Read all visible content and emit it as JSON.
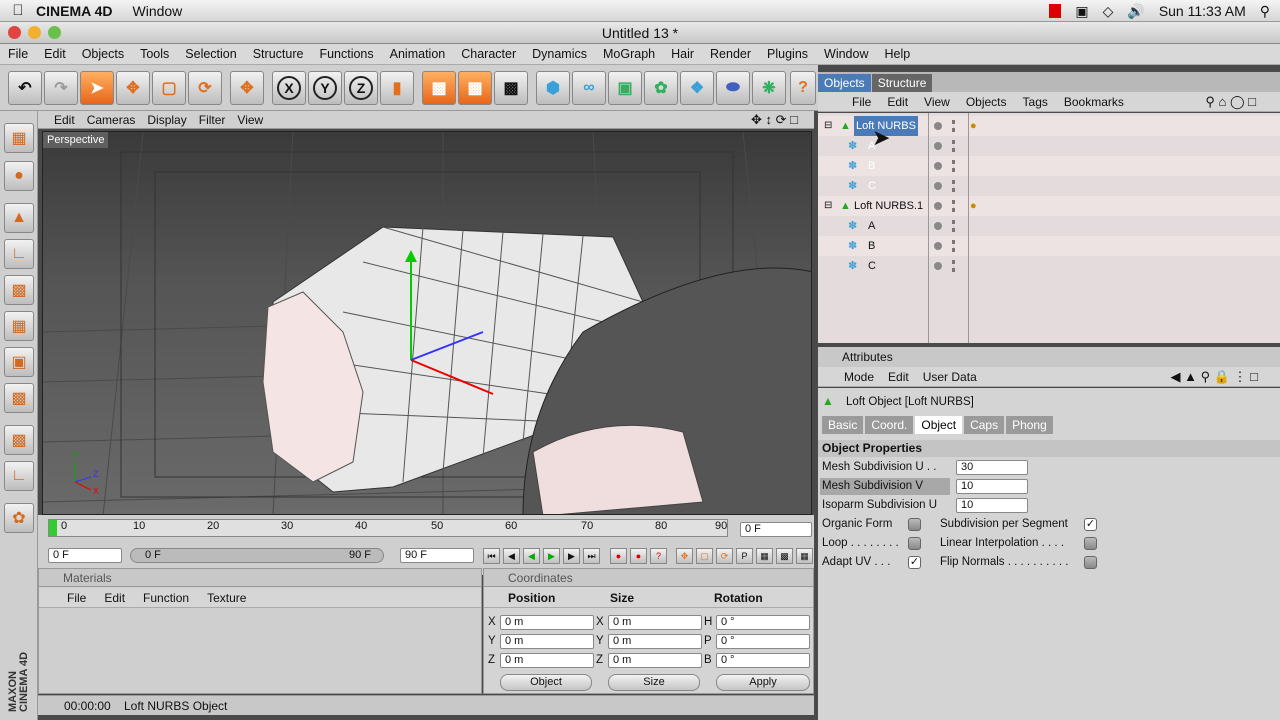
{
  "macbar": {
    "app": "CINEMA 4D",
    "menus": [
      "Window"
    ],
    "clock": "Sun 11:33 AM"
  },
  "window": {
    "title": "Untitled 13 *"
  },
  "appmenu": [
    "File",
    "Edit",
    "Objects",
    "Tools",
    "Selection",
    "Structure",
    "Functions",
    "Animation",
    "Character",
    "Dynamics",
    "MoGraph",
    "Hair",
    "Render",
    "Plugins",
    "Window",
    "Help"
  ],
  "toolbar": {
    "axis_x": "X",
    "axis_y": "Y",
    "axis_z": "Z"
  },
  "viewport": {
    "menu": [
      "Edit",
      "Cameras",
      "Display",
      "Filter",
      "View"
    ],
    "label": "Perspective"
  },
  "timeline": {
    "ticks": [
      "0",
      "10",
      "20",
      "30",
      "40",
      "50",
      "60",
      "70",
      "80",
      "90"
    ],
    "current_frame": "0 F",
    "start": "0 F",
    "range_start": "0 F",
    "range_end": "90 F",
    "end": "90 F",
    "progress": 0
  },
  "materials": {
    "title": "Materials",
    "menu": [
      "File",
      "Edit",
      "Function",
      "Texture"
    ]
  },
  "coordinates": {
    "title": "Coordinates",
    "headers": [
      "Position",
      "Size",
      "Rotation"
    ],
    "rows": [
      {
        "axis": "X",
        "pos": "0 m",
        "size_axis": "X",
        "size": "0 m",
        "rot_axis": "H",
        "rot": "0 °"
      },
      {
        "axis": "Y",
        "pos": "0 m",
        "size_axis": "Y",
        "size": "0 m",
        "rot_axis": "P",
        "rot": "0 °"
      },
      {
        "axis": "Z",
        "pos": "0 m",
        "size_axis": "Z",
        "size": "0 m",
        "rot_axis": "B",
        "rot": "0 °"
      }
    ],
    "mode_select": "Object",
    "size_select": "Size",
    "apply": "Apply"
  },
  "status": {
    "time": "00:00:00",
    "message": "Loft NURBS Object"
  },
  "objects": {
    "tabs": [
      "Objects",
      "Structure"
    ],
    "menu": [
      "File",
      "Edit",
      "View",
      "Objects",
      "Tags",
      "Bookmarks"
    ],
    "rows": [
      {
        "name": "Loft NURBS",
        "child": false
      },
      {
        "name": "A",
        "child": true
      },
      {
        "name": "B",
        "child": true
      },
      {
        "name": "C",
        "child": true
      },
      {
        "name": "Loft NURBS.1",
        "child": false
      },
      {
        "name": "A",
        "child": true
      },
      {
        "name": "B",
        "child": true
      },
      {
        "name": "C",
        "child": true
      }
    ]
  },
  "attributes": {
    "title": "Attributes",
    "menu": [
      "Mode",
      "Edit",
      "User Data"
    ],
    "object_title": "Loft Object [Loft NURBS]",
    "tabs": [
      "Basic",
      "Coord.",
      "Object",
      "Caps",
      "Phong"
    ],
    "section": "Object Properties",
    "mesh_u_label": "Mesh Subdivision U . .",
    "mesh_u": "30",
    "mesh_v_label": "Mesh Subdivision V",
    "mesh_v": "10",
    "iso_label": "Isoparm Subdivision U",
    "iso": "10",
    "organic": "Organic Form",
    "subseg": "Subdivision per Segment",
    "loop": "Loop . . . . . . . .",
    "linear": "Linear Interpolation . . . .",
    "adapt": "Adapt UV . . .",
    "flip": "Flip Normals . . . . . . . . . ."
  }
}
